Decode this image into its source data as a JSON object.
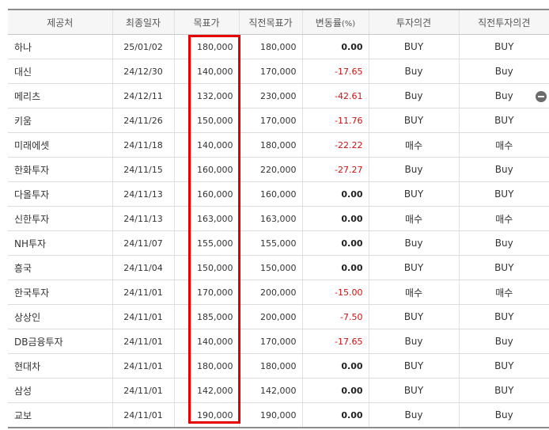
{
  "table": {
    "headers": [
      "제공처",
      "최종일자",
      "목표가",
      "직전목표가",
      "변동률",
      "(%)",
      "투자의견",
      "직전투자의견"
    ],
    "rows": [
      {
        "broker": "하나",
        "date": "25/01/02",
        "target": "180,000",
        "prev_target": "180,000",
        "change": "0.00",
        "opinion": "BUY",
        "prev_opinion": "BUY"
      },
      {
        "broker": "대신",
        "date": "24/12/30",
        "target": "140,000",
        "prev_target": "170,000",
        "change": "-17.65",
        "opinion": "Buy",
        "prev_opinion": "Buy"
      },
      {
        "broker": "메리츠",
        "date": "24/12/11",
        "target": "132,000",
        "prev_target": "230,000",
        "change": "-42.61",
        "opinion": "Buy",
        "prev_opinion": "Buy"
      },
      {
        "broker": "키움",
        "date": "24/11/26",
        "target": "150,000",
        "prev_target": "170,000",
        "change": "-11.76",
        "opinion": "BUY",
        "prev_opinion": "BUY"
      },
      {
        "broker": "미래에셋",
        "date": "24/11/18",
        "target": "140,000",
        "prev_target": "180,000",
        "change": "-22.22",
        "opinion": "매수",
        "prev_opinion": "매수"
      },
      {
        "broker": "한화투자",
        "date": "24/11/15",
        "target": "160,000",
        "prev_target": "220,000",
        "change": "-27.27",
        "opinion": "Buy",
        "prev_opinion": "Buy"
      },
      {
        "broker": "다올투자",
        "date": "24/11/13",
        "target": "160,000",
        "prev_target": "160,000",
        "change": "0.00",
        "opinion": "BUY",
        "prev_opinion": "BUY"
      },
      {
        "broker": "신한투자",
        "date": "24/11/13",
        "target": "163,000",
        "prev_target": "163,000",
        "change": "0.00",
        "opinion": "매수",
        "prev_opinion": "매수"
      },
      {
        "broker": "NH투자",
        "date": "24/11/07",
        "target": "155,000",
        "prev_target": "155,000",
        "change": "0.00",
        "opinion": "Buy",
        "prev_opinion": "Buy"
      },
      {
        "broker": "흥국",
        "date": "24/11/04",
        "target": "150,000",
        "prev_target": "150,000",
        "change": "0.00",
        "opinion": "BUY",
        "prev_opinion": "BUY"
      },
      {
        "broker": "한국투자",
        "date": "24/11/01",
        "target": "170,000",
        "prev_target": "200,000",
        "change": "-15.00",
        "opinion": "매수",
        "prev_opinion": "매수"
      },
      {
        "broker": "상상인",
        "date": "24/11/01",
        "target": "185,000",
        "prev_target": "200,000",
        "change": "-7.50",
        "opinion": "BUY",
        "prev_opinion": "BUY"
      },
      {
        "broker": "DB금융투자",
        "date": "24/11/01",
        "target": "140,000",
        "prev_target": "170,000",
        "change": "-17.65",
        "opinion": "Buy",
        "prev_opinion": "Buy"
      },
      {
        "broker": "현대차",
        "date": "24/11/01",
        "target": "180,000",
        "prev_target": "180,000",
        "change": "0.00",
        "opinion": "BUY",
        "prev_opinion": "BUY"
      },
      {
        "broker": "삼성",
        "date": "24/11/01",
        "target": "142,000",
        "prev_target": "142,000",
        "change": "0.00",
        "opinion": "BUY",
        "prev_opinion": "BUY"
      },
      {
        "broker": "교보",
        "date": "24/11/01",
        "target": "190,000",
        "prev_target": "190,000",
        "change": "0.00",
        "opinion": "Buy",
        "prev_opinion": "Buy"
      }
    ]
  },
  "annotation": {
    "highlight_color": "#e60000",
    "highlight_target": "목표가"
  },
  "colors": {
    "negative": "#c81414",
    "header_bg": "#f6f6f6"
  },
  "icons": {
    "row_action": "minus-circle-icon"
  }
}
